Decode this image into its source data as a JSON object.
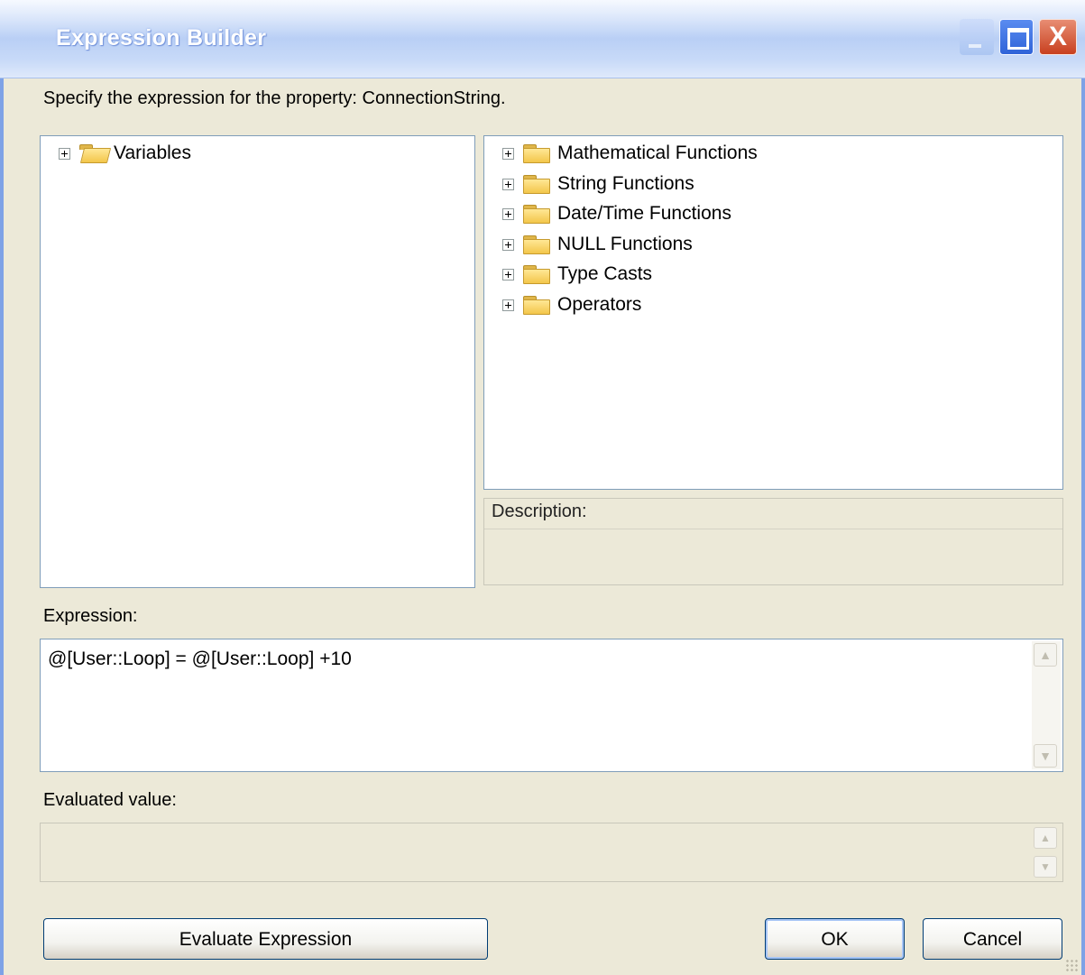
{
  "window": {
    "title": "Expression Builder",
    "close_glyph": "X"
  },
  "prompt_text": "Specify the expression for the property: ConnectionString.",
  "variables_tree": {
    "items": [
      {
        "label": "Variables",
        "icon": "folder-open-icon"
      }
    ]
  },
  "functions_tree": {
    "items": [
      {
        "label": "Mathematical Functions",
        "icon": "folder-icon"
      },
      {
        "label": "String Functions",
        "icon": "folder-icon"
      },
      {
        "label": "Date/Time Functions",
        "icon": "folder-icon"
      },
      {
        "label": "NULL Functions",
        "icon": "folder-icon"
      },
      {
        "label": "Type Casts",
        "icon": "folder-icon"
      },
      {
        "label": "Operators",
        "icon": "folder-icon"
      }
    ]
  },
  "description": {
    "label": "Description:",
    "value": ""
  },
  "expression": {
    "label": "Expression:",
    "value": "@[User::Loop] = @[User::Loop] +10"
  },
  "evaluated": {
    "label": "Evaluated value:",
    "value": ""
  },
  "buttons": {
    "evaluate_label": "Evaluate Expression",
    "ok_label": "OK",
    "cancel_label": "Cancel"
  },
  "colors": {
    "title_gradient": "#b9cff5",
    "dialog_background": "#ece9d8",
    "panel_border": "#7f9db9",
    "button_border": "#003c74"
  }
}
